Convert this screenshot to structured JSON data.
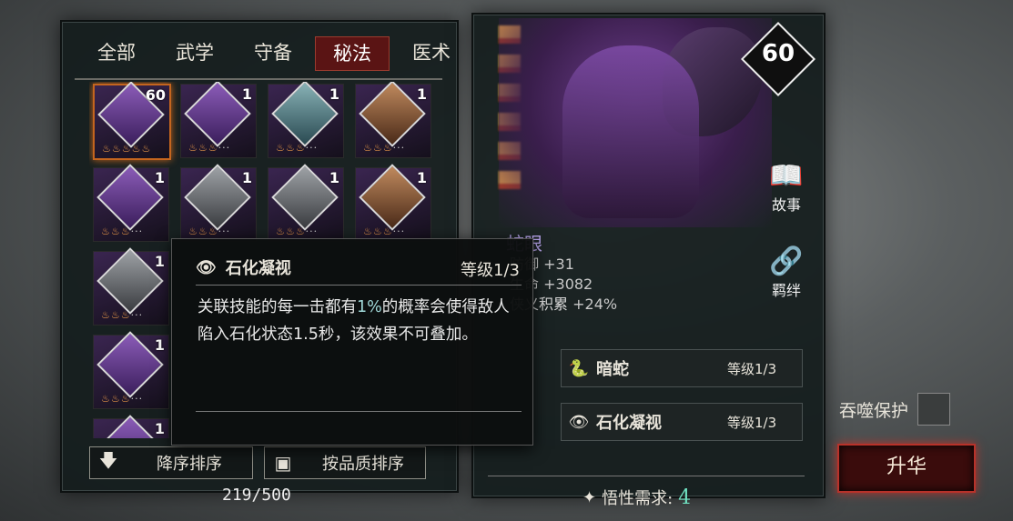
{
  "tabs": [
    "全部",
    "武学",
    "守备",
    "秘法",
    "医术"
  ],
  "active_tab": 3,
  "cards": [
    {
      "count": "60",
      "color": "purple",
      "selected": true
    },
    {
      "count": "1",
      "color": "purple"
    },
    {
      "count": "1",
      "color": "teal"
    },
    {
      "count": "1",
      "color": "brown"
    },
    {
      "count": "1",
      "color": "purple"
    },
    {
      "count": "1",
      "color": "gray"
    },
    {
      "count": "1",
      "color": "gray"
    },
    {
      "count": "1",
      "color": "brown"
    },
    {
      "count": "1",
      "color": "gray"
    },
    {
      "count": "1",
      "color": "purple"
    },
    {
      "count": "1",
      "color": "purple"
    }
  ],
  "tooltip": {
    "title": "石化凝视",
    "level": "等级1/3",
    "body_pre": "关联技能的每一击都有",
    "body_hl": "1%",
    "body_post": "的概率会使得敌人陷入石化状态1.5秒，该效果不可叠加。"
  },
  "sort": {
    "desc_label": "降序排序",
    "quality_label": "按品质排序"
  },
  "capacity": "219/500",
  "level": "60",
  "side": {
    "story": "故事",
    "bond": "羁绊"
  },
  "character": {
    "name": "蛇眼",
    "stats": [
      {
        "label": "防御",
        "value": "+31"
      },
      {
        "label": "生命",
        "value": "+3082"
      },
      {
        "label": "侠义积累",
        "value": "+24%"
      }
    ]
  },
  "skills": [
    {
      "name": "暗蛇",
      "level": "等级1/3"
    },
    {
      "name": "石化凝视",
      "level": "等级1/3"
    }
  ],
  "aptitude": {
    "label": "悟性需求:",
    "value": "4"
  },
  "protect_label": "吞噬保护",
  "ascend_label": "升华"
}
